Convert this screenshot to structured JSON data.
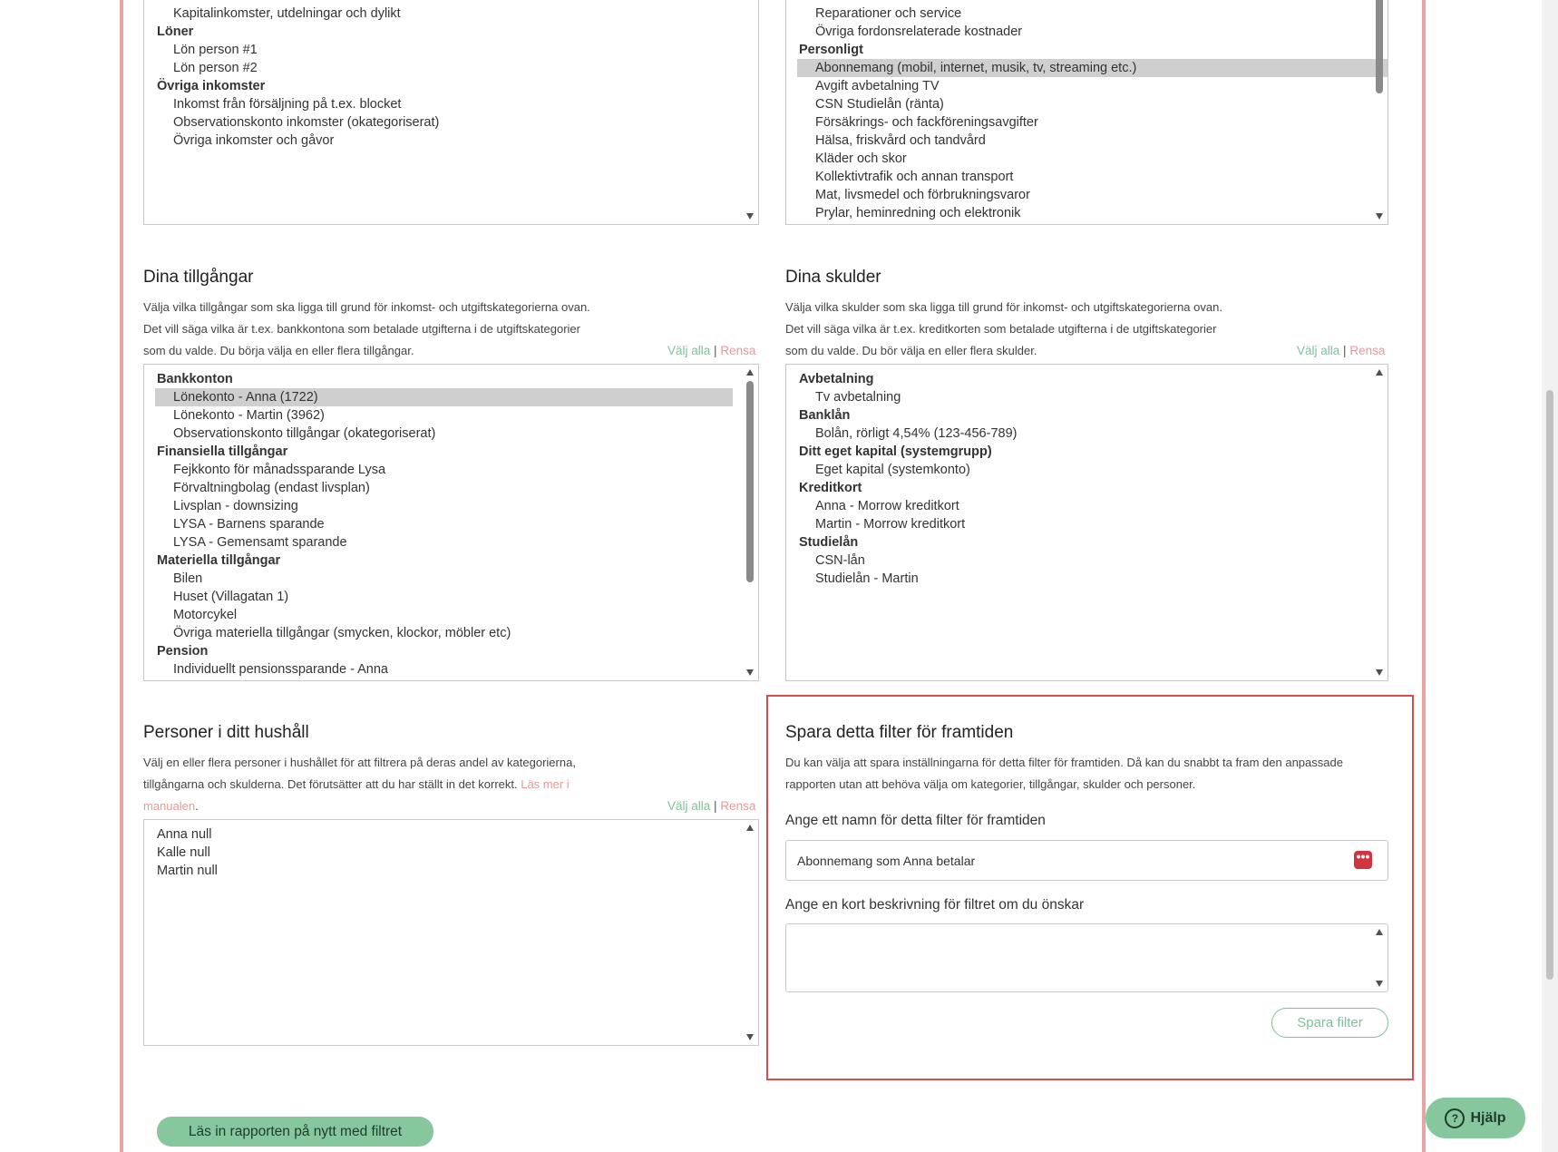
{
  "income_list": {
    "items": [
      {
        "type": "option",
        "label": "Kapitalinkomster, utdelningar och dylikt"
      },
      {
        "type": "group",
        "label": "Löner"
      },
      {
        "type": "option",
        "label": "Lön person #1"
      },
      {
        "type": "option",
        "label": "Lön person #2"
      },
      {
        "type": "group",
        "label": "Övriga inkomster"
      },
      {
        "type": "option",
        "label": "Inkomst från försäljning på t.ex. blocket"
      },
      {
        "type": "option",
        "label": "Observationskonto inkomster (okategoriserat)"
      },
      {
        "type": "option",
        "label": "Övriga inkomster och gåvor"
      }
    ]
  },
  "expense_list": {
    "items": [
      {
        "type": "option",
        "label": "Reparationer och service"
      },
      {
        "type": "option",
        "label": "Övriga fordonsrelaterade kostnader"
      },
      {
        "type": "group",
        "label": "Personligt"
      },
      {
        "type": "option",
        "label": "Abonnemang (mobil, internet, musik, tv, streaming etc.)",
        "selected": true
      },
      {
        "type": "option",
        "label": "Avgift avbetalning TV"
      },
      {
        "type": "option",
        "label": "CSN Studielån (ränta)"
      },
      {
        "type": "option",
        "label": "Försäkrings- och fackföreningsavgifter"
      },
      {
        "type": "option",
        "label": "Hälsa, friskvård och tandvård"
      },
      {
        "type": "option",
        "label": "Kläder och skor"
      },
      {
        "type": "option",
        "label": "Kollektivtrafik och annan transport"
      },
      {
        "type": "option",
        "label": "Mat, livsmedel och förbrukningsvaror"
      },
      {
        "type": "option",
        "label": "Prylar, heminredning och elektronik"
      }
    ]
  },
  "assets": {
    "title": "Dina tillgångar",
    "description": "Välja vilka tillgångar som ska ligga till grund för inkomst- och utgiftskategorierna ovan. Det vill säga vilka är t.ex. bankkontona som betalade utgifterna i de utgiftskategorier som du valde. Du börja välja en eller flera tillgångar.",
    "select_all": "Välj alla",
    "separator": "|",
    "clear": "Rensa",
    "items": [
      {
        "type": "group",
        "label": "Bankkonton"
      },
      {
        "type": "option",
        "label": "Lönekonto - Anna (1722)",
        "selected": true
      },
      {
        "type": "option",
        "label": "Lönekonto - Martin (3962)"
      },
      {
        "type": "option",
        "label": "Observationskonto tillgångar (okategoriserat)"
      },
      {
        "type": "group",
        "label": "Finansiella tillgångar"
      },
      {
        "type": "option",
        "label": "Fejkkonto för månadssparande Lysa"
      },
      {
        "type": "option",
        "label": "Förvaltningbolag (endast livsplan)"
      },
      {
        "type": "option",
        "label": "Livsplan - downsizing"
      },
      {
        "type": "option",
        "label": "LYSA - Barnens sparande"
      },
      {
        "type": "option",
        "label": "LYSA - Gemensamt sparande"
      },
      {
        "type": "group",
        "label": "Materiella tillgångar"
      },
      {
        "type": "option",
        "label": "Bilen"
      },
      {
        "type": "option",
        "label": "Huset (Villagatan 1)"
      },
      {
        "type": "option",
        "label": "Motorcykel"
      },
      {
        "type": "option",
        "label": "Övriga materiella tillgångar (smycken, klockor, möbler etc)"
      },
      {
        "type": "group",
        "label": "Pension"
      },
      {
        "type": "option",
        "label": "Individuellt pensionssparande - Anna"
      }
    ]
  },
  "debts": {
    "title": "Dina skulder",
    "description": "Välja vilka skulder som ska ligga till grund för inkomst- och utgiftskategorierna ovan. Det vill säga vilka är t.ex. kreditkorten som betalade utgifterna i de utgiftskategorier som du valde. Du bör välja en eller flera skulder.",
    "select_all": "Välj alla",
    "separator": "|",
    "clear": "Rensa",
    "items": [
      {
        "type": "group",
        "label": "Avbetalning"
      },
      {
        "type": "option",
        "label": "Tv avbetalning"
      },
      {
        "type": "group",
        "label": "Banklån"
      },
      {
        "type": "option",
        "label": "Bolån, rörligt 4,54% (123-456-789)"
      },
      {
        "type": "group",
        "label": "Ditt eget kapital (systemgrupp)"
      },
      {
        "type": "option",
        "label": "Eget kapital (systemkonto)"
      },
      {
        "type": "group",
        "label": "Kreditkort"
      },
      {
        "type": "option",
        "label": "Anna - Morrow kreditkort"
      },
      {
        "type": "option",
        "label": "Martin - Morrow kreditkort"
      },
      {
        "type": "group",
        "label": "Studielån"
      },
      {
        "type": "option",
        "label": "CSN-lån"
      },
      {
        "type": "option",
        "label": "Studielån - Martin"
      }
    ]
  },
  "household": {
    "title": "Personer i ditt hushåll",
    "description_start": "Välj en eller flera personer i hushållet för att filtrera på deras andel av kategorierna, tillgångarna och skulderna. Det förutsätter att du har ställt in det korrekt. ",
    "manual_link": "Läs mer i manualen",
    "description_end": ".",
    "select_all": "Välj alla",
    "separator": "|",
    "clear": "Rensa",
    "persons": [
      "Anna null",
      "Kalle null",
      "Martin null"
    ]
  },
  "save_filter": {
    "title": "Spara detta filter för framtiden",
    "description": "Du kan välja att spara inställningarna för detta filter för framtiden. Då kan du snabbt ta fram den anpassade rapporten utan att behöva välja om kategorier, tillgångar, skulder och personer.",
    "name_label": "Ange ett namn för detta filter för framtiden",
    "name_value": "Abonnemang som Anna betalar",
    "desc_label": "Ange en kort beskrivning för filtret om du önskar",
    "desc_value": "",
    "save_button": "Spara filter",
    "pw_icon_glyph": "•••"
  },
  "reload_button": "Läs in rapporten på nytt med filtret",
  "help_button": "Hjälp",
  "help_icon_glyph": "?",
  "colors": {
    "frame": "#e8a3a3",
    "highlight_border": "#de4b4b",
    "green": "#86c79e",
    "link_green": "#7fc09a",
    "link_red": "#e49a9a",
    "password_icon": "#d0343e"
  },
  "icons": [
    "scroll-up-arrow-icon",
    "scroll-down-arrow-icon",
    "password-manager-icon",
    "help-circle-icon"
  ]
}
